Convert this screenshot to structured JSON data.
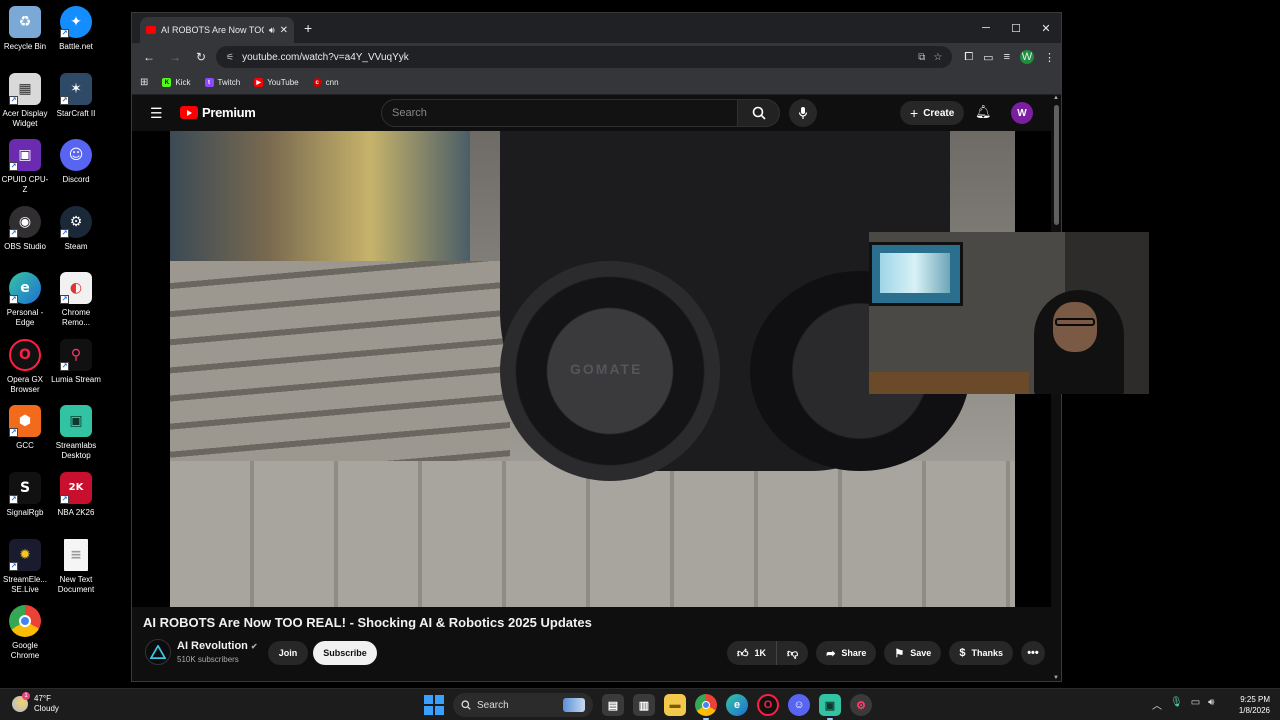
{
  "desktop": {
    "icons": [
      {
        "label": "Recycle Bin"
      },
      {
        "label": "Battle.net"
      },
      {
        "label": "Acer Display Widget"
      },
      {
        "label": "StarCraft II"
      },
      {
        "label": "CPUID CPU-Z"
      },
      {
        "label": "Discord"
      },
      {
        "label": "OBS Studio"
      },
      {
        "label": "Steam"
      },
      {
        "label": "Personal - Edge"
      },
      {
        "label": "Chrome Remo..."
      },
      {
        "label": "Opera GX Browser"
      },
      {
        "label": "Lumia Stream"
      },
      {
        "label": "GCC"
      },
      {
        "label": "Streamlabs Desktop"
      },
      {
        "label": "SignalRgb"
      },
      {
        "label": "NBA 2K26"
      },
      {
        "label": "StreamEle... SE.Live"
      },
      {
        "label": "New Text Document"
      },
      {
        "label": "Google Chrome"
      }
    ]
  },
  "browser": {
    "tab_title": "AI ROBOTS Are Now TOO REAL! - Shocking AI & Robotics 2025 Updates",
    "url": "youtube.com/watch?v=a4Y_VVuqYyk",
    "bookmarks": [
      {
        "label": "Kick",
        "color": "#53fc18"
      },
      {
        "label": "Twitch",
        "color": "#9146ff"
      },
      {
        "label": "YouTube",
        "color": "#ff0000"
      },
      {
        "label": "cnn",
        "color": "#cc0000"
      }
    ],
    "profile_initial": "W"
  },
  "youtube": {
    "logo_text": "Premium",
    "search_placeholder": "Search",
    "create_label": "Create",
    "avatar_initial": "W",
    "video_brand_text": "GOMATE",
    "video_title": "AI ROBOTS Are Now TOO REAL! - Shocking AI & Robotics 2025 Updates",
    "channel": {
      "name": "AI Revolution",
      "subscribers": "510K subscribers",
      "join_label": "Join",
      "subscribe_label": "Subscribe"
    },
    "actions": {
      "likes": "1K",
      "share_label": "Share",
      "save_label": "Save",
      "thanks_label": "Thanks"
    }
  },
  "taskbar": {
    "weather_temp": "47°F",
    "weather_desc": "Cloudy",
    "search_label": "Search",
    "time": "9:25 PM",
    "date": "1/8/2026",
    "weather_badge": "1"
  }
}
